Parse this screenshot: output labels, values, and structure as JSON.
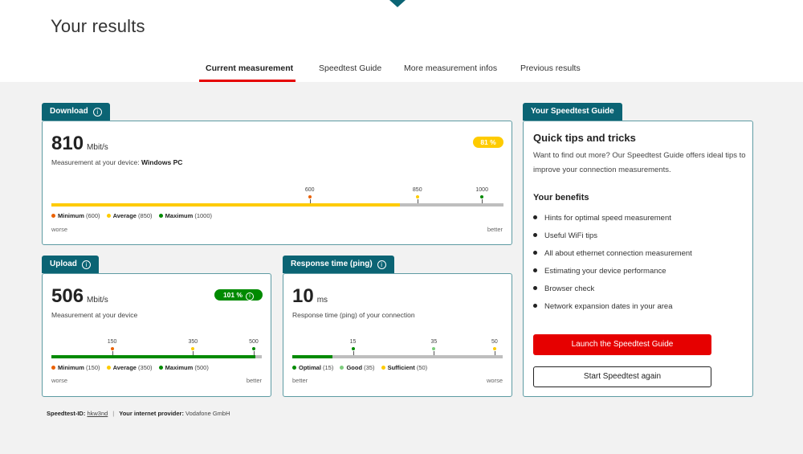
{
  "page": {
    "title": "Your results"
  },
  "tabs": [
    {
      "label": "Current measurement",
      "active": true
    },
    {
      "label": "Speedtest Guide",
      "active": false
    },
    {
      "label": "More measurement infos",
      "active": false
    },
    {
      "label": "Previous results",
      "active": false
    }
  ],
  "colors": {
    "teal": "#0b6474",
    "red": "#e60000",
    "yellow": "#fecb00",
    "green": "#008a00",
    "orange": "#eb6100"
  },
  "download": {
    "header": "Download",
    "header_icon": "info-icon",
    "value": "810",
    "unit": "Mbit/s",
    "desc_prefix": "Measurement at your device:",
    "device": "Windows PC",
    "percent": "81 %",
    "fill_fraction": 0.77,
    "fill_color": "#fecb00",
    "scale_max": 1050,
    "ticks": [
      {
        "value": 600,
        "label": "600",
        "color": "#eb6100"
      },
      {
        "value": 850,
        "label": "850",
        "color": "#fecb00"
      },
      {
        "value": 1000,
        "label": "1000",
        "color": "#008a00"
      }
    ],
    "legend": [
      {
        "name": "Minimum",
        "detail": "(600)",
        "color": "#eb6100"
      },
      {
        "name": "Average",
        "detail": "(850)",
        "color": "#fecb00"
      },
      {
        "name": "Maximum",
        "detail": "(1000)",
        "color": "#008a00"
      }
    ],
    "left_word": "worse",
    "right_word": "better"
  },
  "upload": {
    "header": "Upload",
    "header_icon": "info-icon",
    "value": "506",
    "unit": "Mbit/s",
    "desc": "Measurement at your device",
    "percent": "101 %",
    "fill_fraction": 0.97,
    "fill_color": "#008a00",
    "scale_max": 520,
    "ticks": [
      {
        "value": 150,
        "label": "150",
        "color": "#eb6100"
      },
      {
        "value": 350,
        "label": "350",
        "color": "#fecb00"
      },
      {
        "value": 500,
        "label": "500",
        "color": "#008a00"
      }
    ],
    "legend": [
      {
        "name": "Minimum",
        "detail": "(150)",
        "color": "#eb6100"
      },
      {
        "name": "Average",
        "detail": "(350)",
        "color": "#fecb00"
      },
      {
        "name": "Maximum",
        "detail": "(500)",
        "color": "#008a00"
      }
    ],
    "left_word": "worse",
    "right_word": "better"
  },
  "ping": {
    "header": "Response time (ping)",
    "header_icon": "info-icon",
    "value": "10",
    "unit": "ms",
    "desc": "Response time (ping) of your connection",
    "fill_fraction": 0.19,
    "fill_color": "#008a00",
    "scale_max": 52,
    "ticks": [
      {
        "value": 15,
        "label": "15",
        "color": "#008a00"
      },
      {
        "value": 35,
        "label": "35",
        "color": "#7ccc7c"
      },
      {
        "value": 50,
        "label": "50",
        "color": "#fecb00"
      }
    ],
    "legend": [
      {
        "name": "Optimal",
        "detail": "(15)",
        "color": "#008a00"
      },
      {
        "name": "Good",
        "detail": "(35)",
        "color": "#7ccc7c"
      },
      {
        "name": "Sufficient",
        "detail": "(50)",
        "color": "#fecb00"
      }
    ],
    "left_word": "better",
    "right_word": "worse"
  },
  "guide": {
    "header": "Your Speedtest Guide",
    "title": "Quick tips and tricks",
    "text": "Want to find out more? Our Speedtest Guide offers ideal tips to improve your connection measurements.",
    "benefits_title": "Your benefits",
    "benefits": [
      "Hints for optimal speed measurement",
      "Useful WiFi tips",
      "All about ethernet connection measurement",
      "Estimating your device performance",
      "Browser check",
      "Network expansion dates in your area"
    ],
    "launch_button": "Launch the Speedtest Guide",
    "restart_button": "Start Speedtest again"
  },
  "footer": {
    "id_label": "Speedtest-ID:",
    "id_value": "hkw3nd",
    "separator": "|",
    "provider_label": "Your internet provider:",
    "provider_value": "Vodafone GmbH"
  }
}
